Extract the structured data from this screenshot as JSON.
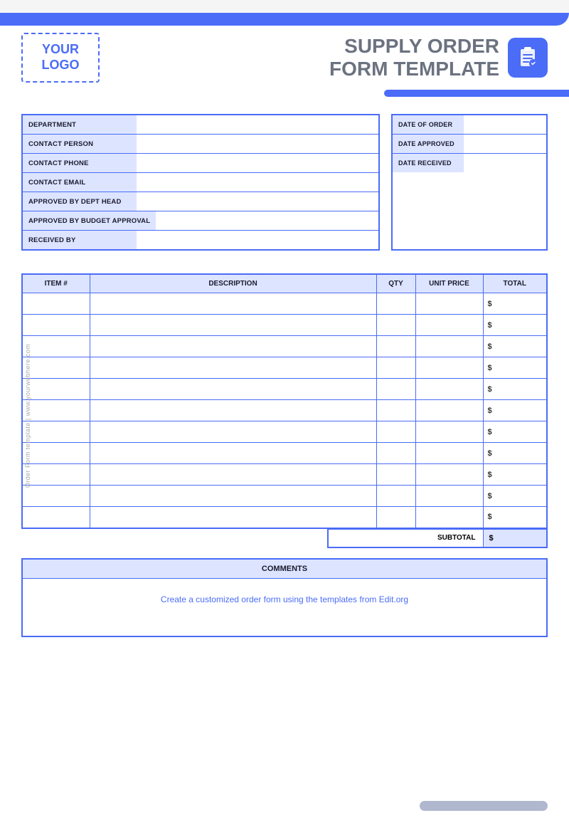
{
  "header": {
    "logo_line1": "YOUR",
    "logo_line2": "LOGO",
    "title_line1": "SUPPLY ORDER",
    "title_line2": "FORM TEMPLATE"
  },
  "accent": {
    "color": "#4a6cf7",
    "light": "#dce4ff"
  },
  "left_fields": [
    {
      "label": "DEPARTMENT",
      "value": ""
    },
    {
      "label": "CONTACT PERSON",
      "value": ""
    },
    {
      "label": "CONTACT PHONE",
      "value": ""
    },
    {
      "label": "CONTACT EMAIL",
      "value": ""
    },
    {
      "label": "APPROVED BY DEPT HEAD",
      "value": ""
    },
    {
      "label": "APPROVED BY BUDGET APPROVAL",
      "value": ""
    },
    {
      "label": "RECEIVED BY",
      "value": ""
    }
  ],
  "right_fields": [
    {
      "label": "DATE OF ORDER",
      "value": ""
    },
    {
      "label": "DATE APPROVED",
      "value": ""
    },
    {
      "label": "DATE RECEIVED",
      "value": ""
    }
  ],
  "table": {
    "headers": [
      "ITEM #",
      "DESCRIPTION",
      "QTY",
      "Unit PRICE",
      "TOTAL"
    ],
    "rows": 11,
    "dollar_sign": "$"
  },
  "subtotal": {
    "label": "SUBTOTAL",
    "value": "$"
  },
  "comments": {
    "header": "COMMENTS",
    "placeholder": "Create a customized order form using the templates from Edit.org"
  },
  "watermark": "Order Form template | www.yourwebhere.com"
}
